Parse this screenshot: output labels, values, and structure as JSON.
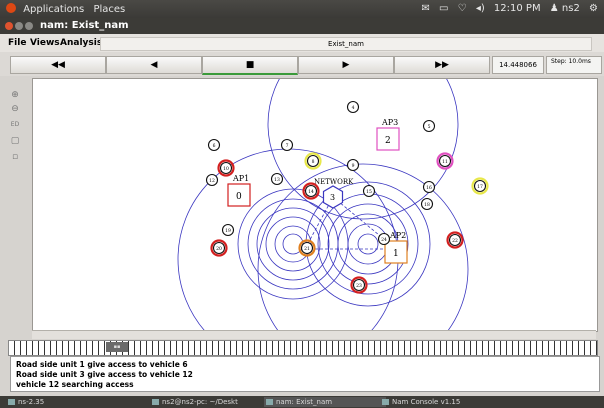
{
  "top_panel": {
    "menu_applications": "Applications",
    "menu_places": "Places",
    "clock": "12:10 PM",
    "user": "ns2"
  },
  "window": {
    "title": "nam: Exist_nam",
    "menus": [
      "File",
      "Views",
      "Analysis"
    ],
    "filename": "Exist_nam"
  },
  "controls": {
    "rewind": "◀◀",
    "back": "◀",
    "stop": "■",
    "play": "▶",
    "fast_forward": "▶▶",
    "time": "14.448066",
    "step": "Step: 10.0ms"
  },
  "network": {
    "colors": {
      "red": "#d32020",
      "yellow": "#e8e84a",
      "pink": "#e050c0",
      "orange": "#e08020",
      "blue": "#3a36c0",
      "link": "#3a36c0"
    },
    "access_points": [
      {
        "label": "AP1",
        "id": "0",
        "color": "#d32020"
      },
      {
        "label": "AP2",
        "id": "1",
        "color": "#e08020"
      },
      {
        "label": "AP3",
        "id": "2",
        "color": "#e050c0"
      }
    ],
    "network_node": {
      "label": "NETWORK",
      "id": "3"
    },
    "node_labels": [
      "4",
      "5",
      "6",
      "7",
      "8",
      "9",
      "10",
      "11",
      "12",
      "13",
      "14",
      "15",
      "16",
      "17",
      "18",
      "19",
      "20",
      "21",
      "22",
      "23",
      "24"
    ]
  },
  "log": {
    "lines": [
      "Road side unit 1 give access to vehicle 6",
      "Road side unit 3 give access to vehicle 12",
      "vehicle 12 searching access"
    ]
  },
  "taskbar": {
    "tasks": [
      "ns-2.35",
      "ns2@ns2-pc: ~/Deskt",
      "nam: Exist_nam",
      "Nam Console v1.15"
    ]
  }
}
